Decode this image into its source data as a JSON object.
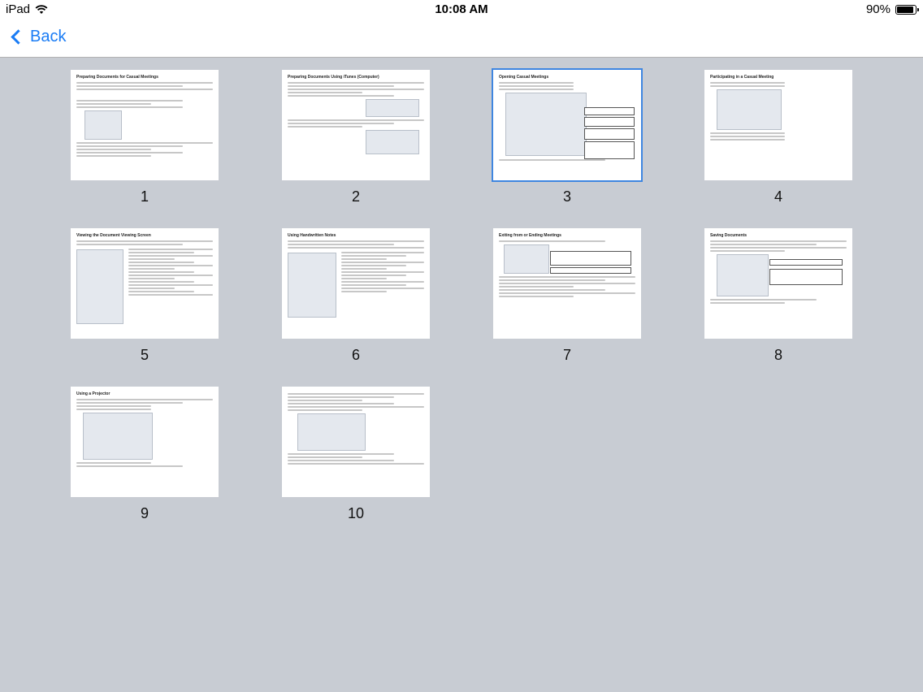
{
  "status_bar": {
    "device": "iPad",
    "time": "10:08 AM",
    "battery_percent": "90%",
    "battery_level": 0.9
  },
  "nav": {
    "back_label": "Back"
  },
  "pages": [
    {
      "number": "1",
      "title": "Preparing Documents for Casual Meetings"
    },
    {
      "number": "2",
      "title": "Preparing Documents Using iTunes (Computer)"
    },
    {
      "number": "3",
      "title": "Opening Casual Meetings"
    },
    {
      "number": "4",
      "title": "Participating in a Casual Meeting"
    },
    {
      "number": "5",
      "title": "Viewing the Document Viewing Screen"
    },
    {
      "number": "6",
      "title": "Using Handwritten Notes"
    },
    {
      "number": "7",
      "title": "Exiting from or Ending Meetings"
    },
    {
      "number": "8",
      "title": "Saving Documents"
    },
    {
      "number": "9",
      "title": "Using a Projector"
    },
    {
      "number": "10",
      "title": ""
    }
  ],
  "selected_page": "3"
}
